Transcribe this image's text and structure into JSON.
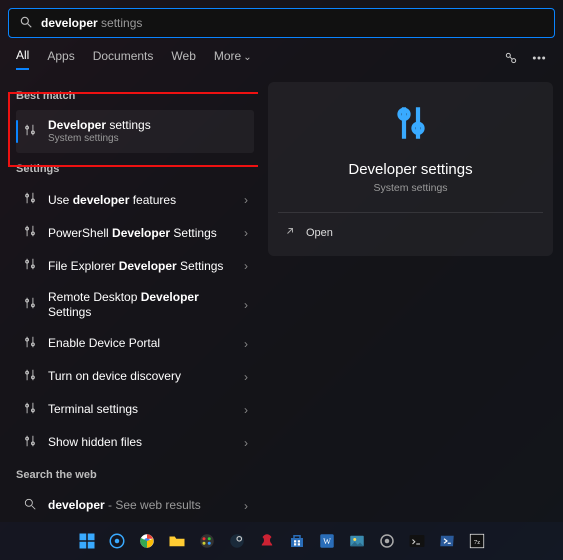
{
  "search": {
    "bold": "developer",
    "rest": " settings"
  },
  "tabs": {
    "all": "All",
    "apps": "Apps",
    "documents": "Documents",
    "web": "Web",
    "more": "More"
  },
  "labels": {
    "best_match": "Best match",
    "settings": "Settings",
    "search_the_web": "Search the web"
  },
  "best_match": {
    "title_bold": "Developer",
    "title_rest": " settings",
    "subtitle": "System settings"
  },
  "settings_rows": [
    {
      "pre": "Use ",
      "bold": "developer",
      "post": " features"
    },
    {
      "pre": "PowerShell ",
      "bold": "Developer",
      "post": " Settings"
    },
    {
      "pre": "File Explorer ",
      "bold": "Developer",
      "post": " Settings"
    },
    {
      "pre": "Remote Desktop ",
      "bold": "Developer",
      "post": " Settings"
    },
    {
      "pre": "",
      "bold": "",
      "post": "Enable Device Portal"
    },
    {
      "pre": "",
      "bold": "",
      "post": "Turn on device discovery"
    },
    {
      "pre": "",
      "bold": "",
      "post": "Terminal settings"
    },
    {
      "pre": "",
      "bold": "",
      "post": "Show hidden files"
    }
  ],
  "web_row": {
    "bold": "developer",
    "rest": " - See web results"
  },
  "preview": {
    "title": "Developer settings",
    "subtitle": "System settings",
    "open": "Open"
  },
  "taskbar_icons": [
    "start",
    "edge",
    "chrome",
    "file-explorer",
    "spotify",
    "steam",
    "devil",
    "microsoft-store",
    "word",
    "photos",
    "settings",
    "terminal",
    "powershell",
    "sevenzip"
  ]
}
